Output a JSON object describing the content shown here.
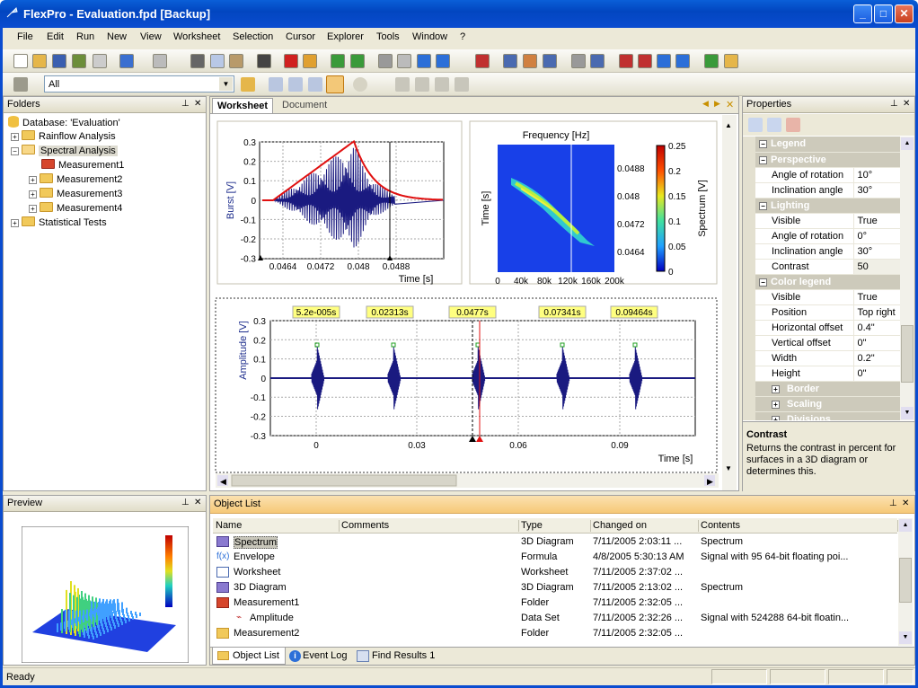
{
  "window": {
    "title": "FlexPro - Evaluation.fpd [Backup]",
    "min": "_",
    "max": "□",
    "close": "✕"
  },
  "menu": [
    "File",
    "Edit",
    "Run",
    "New",
    "View",
    "Worksheet",
    "Selection",
    "Cursor",
    "Explorer",
    "Tools",
    "Window",
    "?"
  ],
  "filter": {
    "value": "All"
  },
  "folders": {
    "title": "Folders",
    "db": "Database: 'Evaluation'",
    "items": [
      {
        "label": "Rainflow Analysis"
      },
      {
        "label": "Spectral Analysis"
      },
      {
        "label": "Measurement1"
      },
      {
        "label": "Measurement2"
      },
      {
        "label": "Measurement3"
      },
      {
        "label": "Measurement4"
      },
      {
        "label": "Statistical Tests"
      }
    ]
  },
  "tabs": {
    "worksheet": "Worksheet",
    "document": "Document"
  },
  "chart1": {
    "ylabel": "Burst [V]",
    "xlabel": "Time [s]",
    "yticks": [
      "0.3",
      "0.2",
      "0.1",
      "0",
      "-0.1",
      "-0.2",
      "-0.3"
    ],
    "xticks": [
      "0.0464",
      "0.0472",
      "0.048",
      "0.0488"
    ]
  },
  "chart2": {
    "title": "Frequency [Hz]",
    "ylabel": "Time [s]",
    "zlabel": "Spectrum [V]",
    "yticks": [
      "0.0488",
      "0.048",
      "0.0472",
      "0.0464"
    ],
    "xticks": [
      "0",
      "40k",
      "80k",
      "120k",
      "160k",
      "200k"
    ],
    "cticks": [
      "0.25",
      "0.2",
      "0.15",
      "0.1",
      "0.05",
      "0"
    ]
  },
  "chart3": {
    "ylabel": "Amplitude [V]",
    "xlabel": "Time [s]",
    "yticks": [
      "0.3",
      "0.2",
      "0.1",
      "0",
      "-0.1",
      "-0.2",
      "-0.3"
    ],
    "xticks": [
      "0",
      "0.03",
      "0.06",
      "0.09"
    ],
    "labels": [
      "5.2e-005s",
      "0.02313s",
      "0.0477s",
      "0.07341s",
      "0.09464s"
    ]
  },
  "properties": {
    "title": "Properties",
    "rows": [
      {
        "c": "Legend"
      },
      {
        "c": "Perspective"
      },
      {
        "k": "Angle of rotation",
        "v": "10°"
      },
      {
        "k": "Inclination angle",
        "v": "30°"
      },
      {
        "c": "Lighting"
      },
      {
        "k": "Visible",
        "v": "True"
      },
      {
        "k": "Angle of rotation",
        "v": "0°"
      },
      {
        "k": "Inclination angle",
        "v": "30°"
      },
      {
        "k": "Contrast",
        "v": "50"
      },
      {
        "c": "Color legend"
      },
      {
        "k": "Visible",
        "v": "True"
      },
      {
        "k": "Position",
        "v": "Top right"
      },
      {
        "k": "Horizontal offset",
        "v": "0.4\""
      },
      {
        "k": "Vertical offset",
        "v": "0\""
      },
      {
        "k": "Width",
        "v": "0.2\""
      },
      {
        "k": "Height",
        "v": "0\""
      },
      {
        "s": "Border"
      },
      {
        "s": "Scaling"
      },
      {
        "s": "Divisions"
      }
    ],
    "help_title": "Contrast",
    "help_text": "Returns the contrast in percent for surfaces in a 3D diagram or determines this."
  },
  "preview": {
    "title": "Preview"
  },
  "objectlist": {
    "title": "Object List",
    "columns": [
      "Name",
      "Comments",
      "Type",
      "Changed on",
      "Contents"
    ],
    "rows": [
      {
        "name": "Spectrum",
        "type": "3D Diagram",
        "changed": "7/11/2005 2:03:11 ...",
        "contents": "Spectrum"
      },
      {
        "name": "Envelope",
        "type": "Formula",
        "changed": "4/8/2005 5:30:13 AM",
        "contents": "Signal with 95 64-bit floating poi..."
      },
      {
        "name": "Worksheet",
        "type": "Worksheet",
        "changed": "7/11/2005 2:37:02 ...",
        "contents": ""
      },
      {
        "name": "3D Diagram",
        "type": "3D Diagram",
        "changed": "7/11/2005 2:13:02 ...",
        "contents": "Spectrum"
      },
      {
        "name": "Measurement1",
        "type": "Folder",
        "changed": "7/11/2005 2:32:05 ...",
        "contents": ""
      },
      {
        "name": "Amplitude",
        "type": "Data Set",
        "changed": "7/11/2005 2:32:26 ...",
        "contents": "Signal with 524288 64-bit floatin..."
      },
      {
        "name": "Measurement2",
        "type": "Folder",
        "changed": "7/11/2005 2:32:05 ...",
        "contents": ""
      }
    ],
    "tabs": [
      "Object List",
      "Event Log",
      "Find Results 1"
    ]
  },
  "status": {
    "text": "Ready"
  }
}
